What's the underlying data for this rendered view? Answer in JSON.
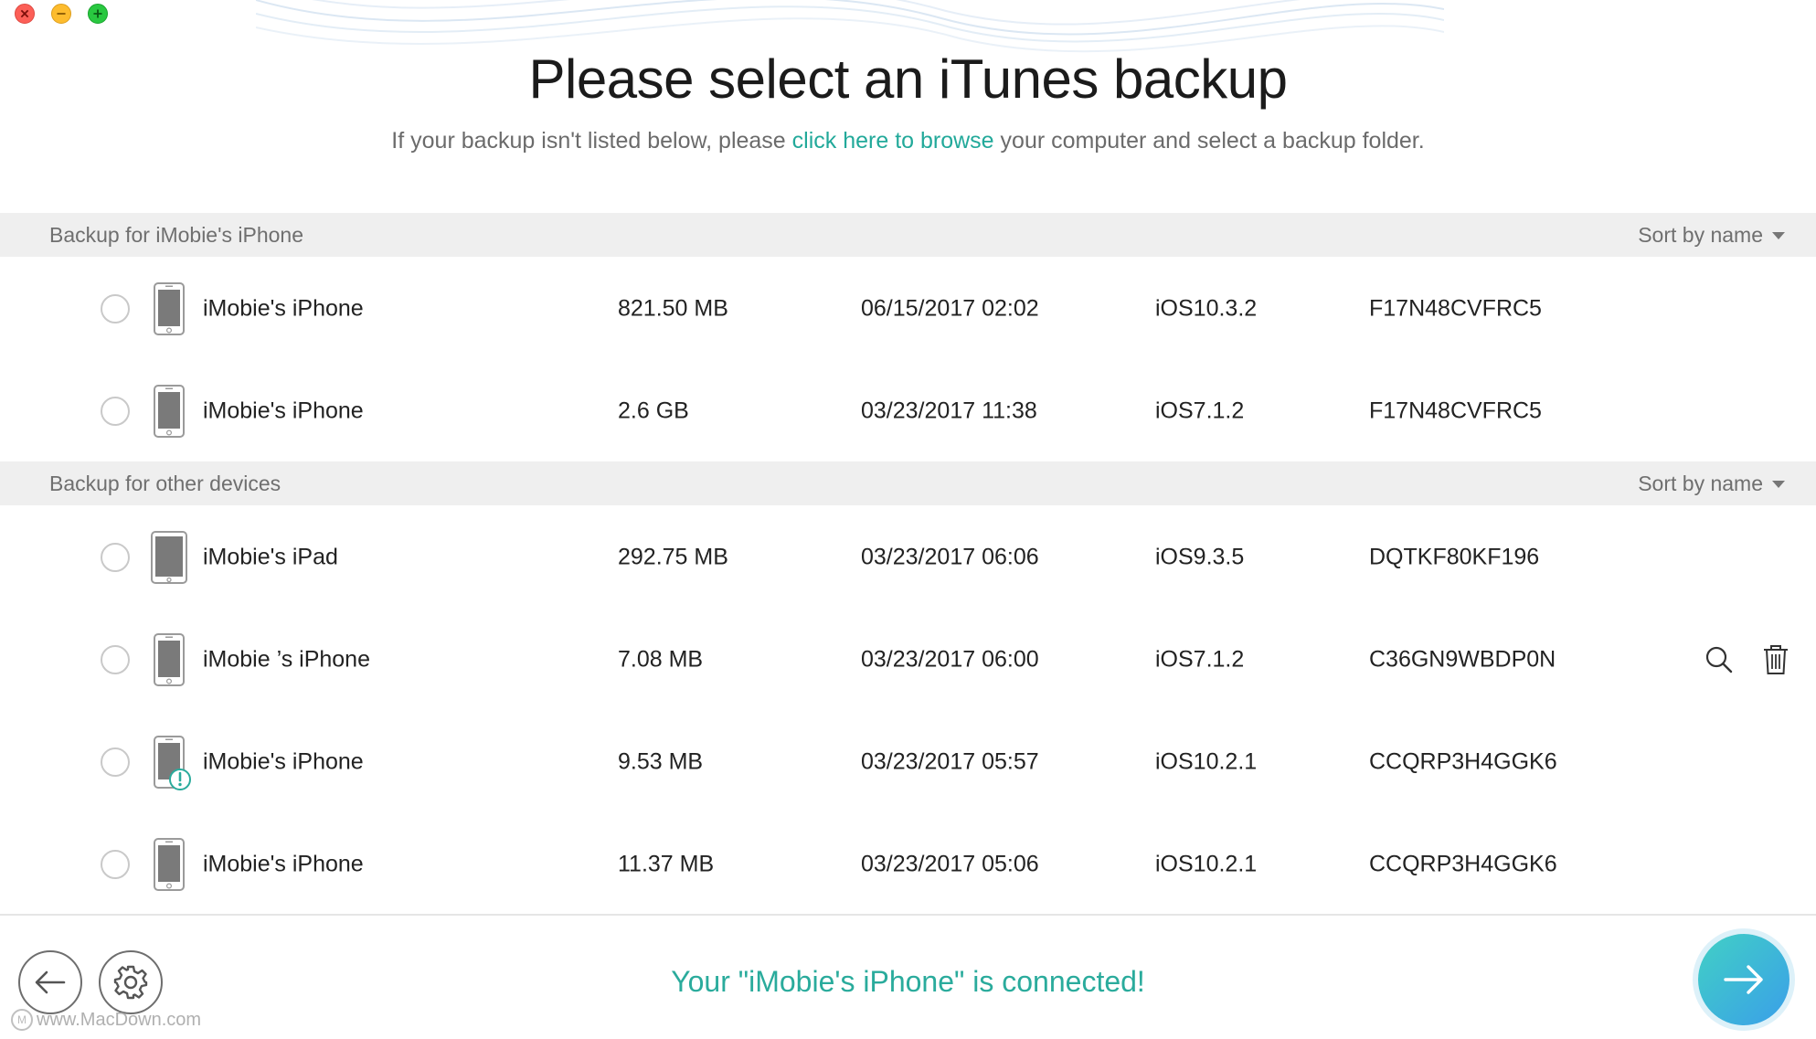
{
  "window": {
    "traffic_lights": [
      "close",
      "minimize",
      "zoom"
    ]
  },
  "header": {
    "title": "Please select an iTunes backup",
    "subtitle_before": "If your backup isn't listed below, please ",
    "subtitle_link": "click here to browse",
    "subtitle_after": " your computer and select a backup folder."
  },
  "sections": [
    {
      "title": "Backup for iMobie's iPhone",
      "sort_label": "Sort by name",
      "rows": [
        {
          "device_icon": "iphone-icon",
          "name": "iMobie's iPhone",
          "size": "821.50 MB",
          "date": "06/15/2017 02:02",
          "ios": "iOS10.3.2",
          "serial": "F17N48CVFRC5"
        },
        {
          "device_icon": "iphone-icon",
          "name": "iMobie's iPhone",
          "size": "2.6 GB",
          "date": "03/23/2017 11:38",
          "ios": "iOS7.1.2",
          "serial": "F17N48CVFRC5"
        }
      ]
    },
    {
      "title": "Backup for other devices",
      "sort_label": "Sort by name",
      "rows": [
        {
          "device_icon": "ipad-icon",
          "name": "iMobie's iPad",
          "size": "292.75 MB",
          "date": "03/23/2017 06:06",
          "ios": "iOS9.3.5",
          "serial": "DQTKF80KF196"
        },
        {
          "device_icon": "iphone-icon",
          "name": "iMobie ’s iPhone",
          "size": "7.08 MB",
          "date": "03/23/2017 06:00",
          "ios": "iOS7.1.2",
          "serial": "C36GN9WBDP0N",
          "actions": [
            "search-icon",
            "trash-icon"
          ]
        },
        {
          "device_icon": "iphone-warning-icon",
          "name": "iMobie's iPhone",
          "size": "9.53 MB",
          "date": "03/23/2017 05:57",
          "ios": "iOS10.2.1",
          "serial": "CCQRP3H4GGK6"
        },
        {
          "device_icon": "iphone-icon",
          "name": "iMobie's iPhone",
          "size": "11.37 MB",
          "date": "03/23/2017 05:06",
          "ios": "iOS10.2.1",
          "serial": "CCQRP3H4GGK6"
        }
      ]
    }
  ],
  "footer": {
    "back_icon": "arrow-left-icon",
    "settings_icon": "gear-icon",
    "status": "Your \"iMobie's iPhone\" is connected!",
    "next_icon": "arrow-right-icon",
    "watermark": "www.MacDown.com"
  },
  "colors": {
    "accent": "#2aab9c",
    "link": "#22a99a",
    "section_bg": "#efefef",
    "next_gradient_start": "#41d0c5",
    "next_gradient_end": "#3a9fe9"
  }
}
